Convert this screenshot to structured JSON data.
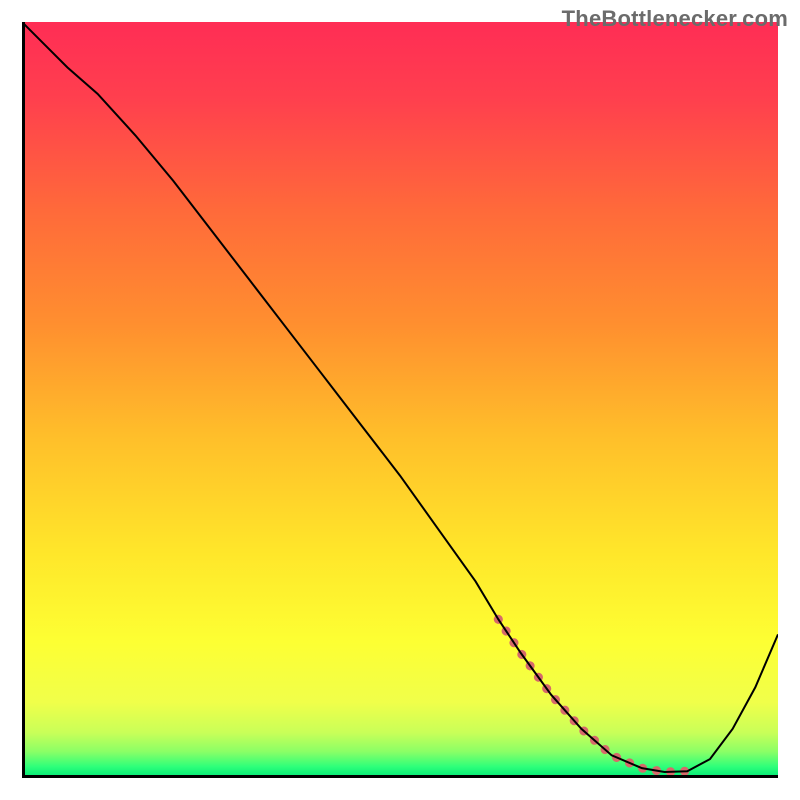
{
  "attribution": "TheBottlenecker.com",
  "chart_data": {
    "type": "line",
    "title": "",
    "xlabel": "",
    "ylabel": "",
    "xlim": [
      0,
      100
    ],
    "ylim": [
      0,
      100
    ],
    "grid": false,
    "legend": false,
    "gradient_stops": [
      {
        "offset": 0.0,
        "color": "#ff2d55"
      },
      {
        "offset": 0.1,
        "color": "#ff3f4e"
      },
      {
        "offset": 0.25,
        "color": "#ff6a3a"
      },
      {
        "offset": 0.4,
        "color": "#ff8f2f"
      },
      {
        "offset": 0.55,
        "color": "#ffbf2a"
      },
      {
        "offset": 0.7,
        "color": "#ffe62a"
      },
      {
        "offset": 0.82,
        "color": "#fdff33"
      },
      {
        "offset": 0.9,
        "color": "#f0ff4a"
      },
      {
        "offset": 0.94,
        "color": "#c9ff58"
      },
      {
        "offset": 0.965,
        "color": "#8bff66"
      },
      {
        "offset": 0.985,
        "color": "#2eff7a"
      },
      {
        "offset": 1.0,
        "color": "#00e876"
      }
    ],
    "curve": {
      "description": "Bottleneck percentage vs component strength; valley at optimal match",
      "color": "#000000",
      "width": 2,
      "x": [
        0,
        3,
        6,
        10,
        15,
        20,
        25,
        30,
        35,
        40,
        45,
        50,
        55,
        60,
        63,
        66,
        70,
        74,
        78,
        82,
        85,
        88,
        91,
        94,
        97,
        100
      ],
      "y": [
        100,
        97,
        94,
        90.5,
        85,
        79,
        72.5,
        66,
        59.5,
        53,
        46.5,
        40,
        33,
        26,
        21,
        16.5,
        11,
        6.5,
        3,
        1.3,
        0.8,
        0.9,
        2.5,
        6.5,
        12,
        19
      ]
    },
    "highlight_band": {
      "description": "Flat valley region highlighted with rounded dashed pink marker",
      "color": "#d66a6a",
      "width": 9,
      "linecap": "round",
      "dash": "0.1 14",
      "x": [
        63,
        66,
        70,
        74,
        78,
        82,
        85,
        88
      ],
      "y": [
        21,
        16.5,
        11,
        6.5,
        3,
        1.3,
        0.8,
        0.9
      ]
    }
  }
}
